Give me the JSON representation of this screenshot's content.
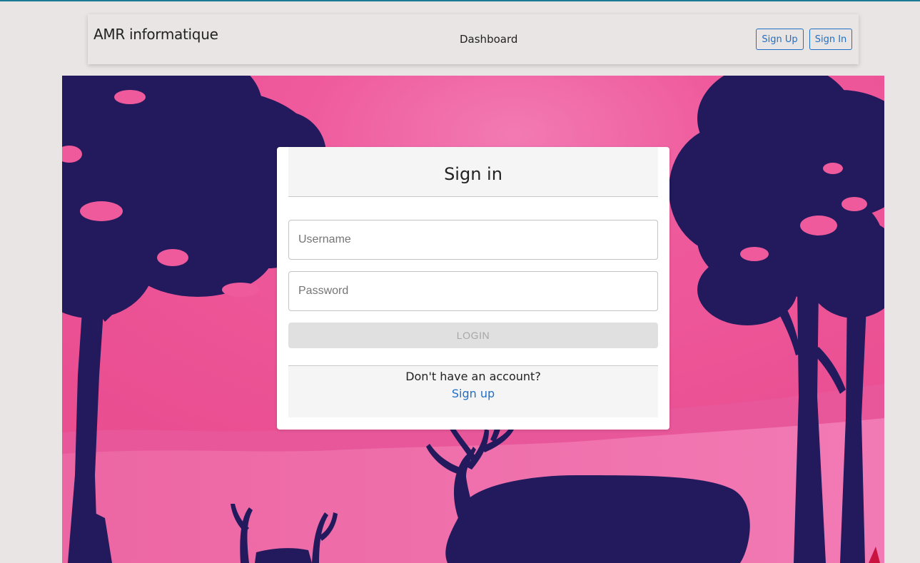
{
  "navbar": {
    "brand": "AMR informatique",
    "dashboard_link": "Dashboard",
    "signup_button": "Sign Up",
    "signin_button": "Sign In"
  },
  "login_card": {
    "title": "Sign in",
    "username": {
      "placeholder": "Username",
      "value": ""
    },
    "password": {
      "placeholder": "Password",
      "value": ""
    },
    "login_button": "LOGIN",
    "footer_text": "Don't have an account?",
    "signup_link": "Sign up"
  },
  "colors": {
    "accent": "#1f6fc6",
    "background": "#e9e5e4",
    "scene_pink": "#ee5a9a",
    "scene_silhouette": "#221a5c"
  }
}
